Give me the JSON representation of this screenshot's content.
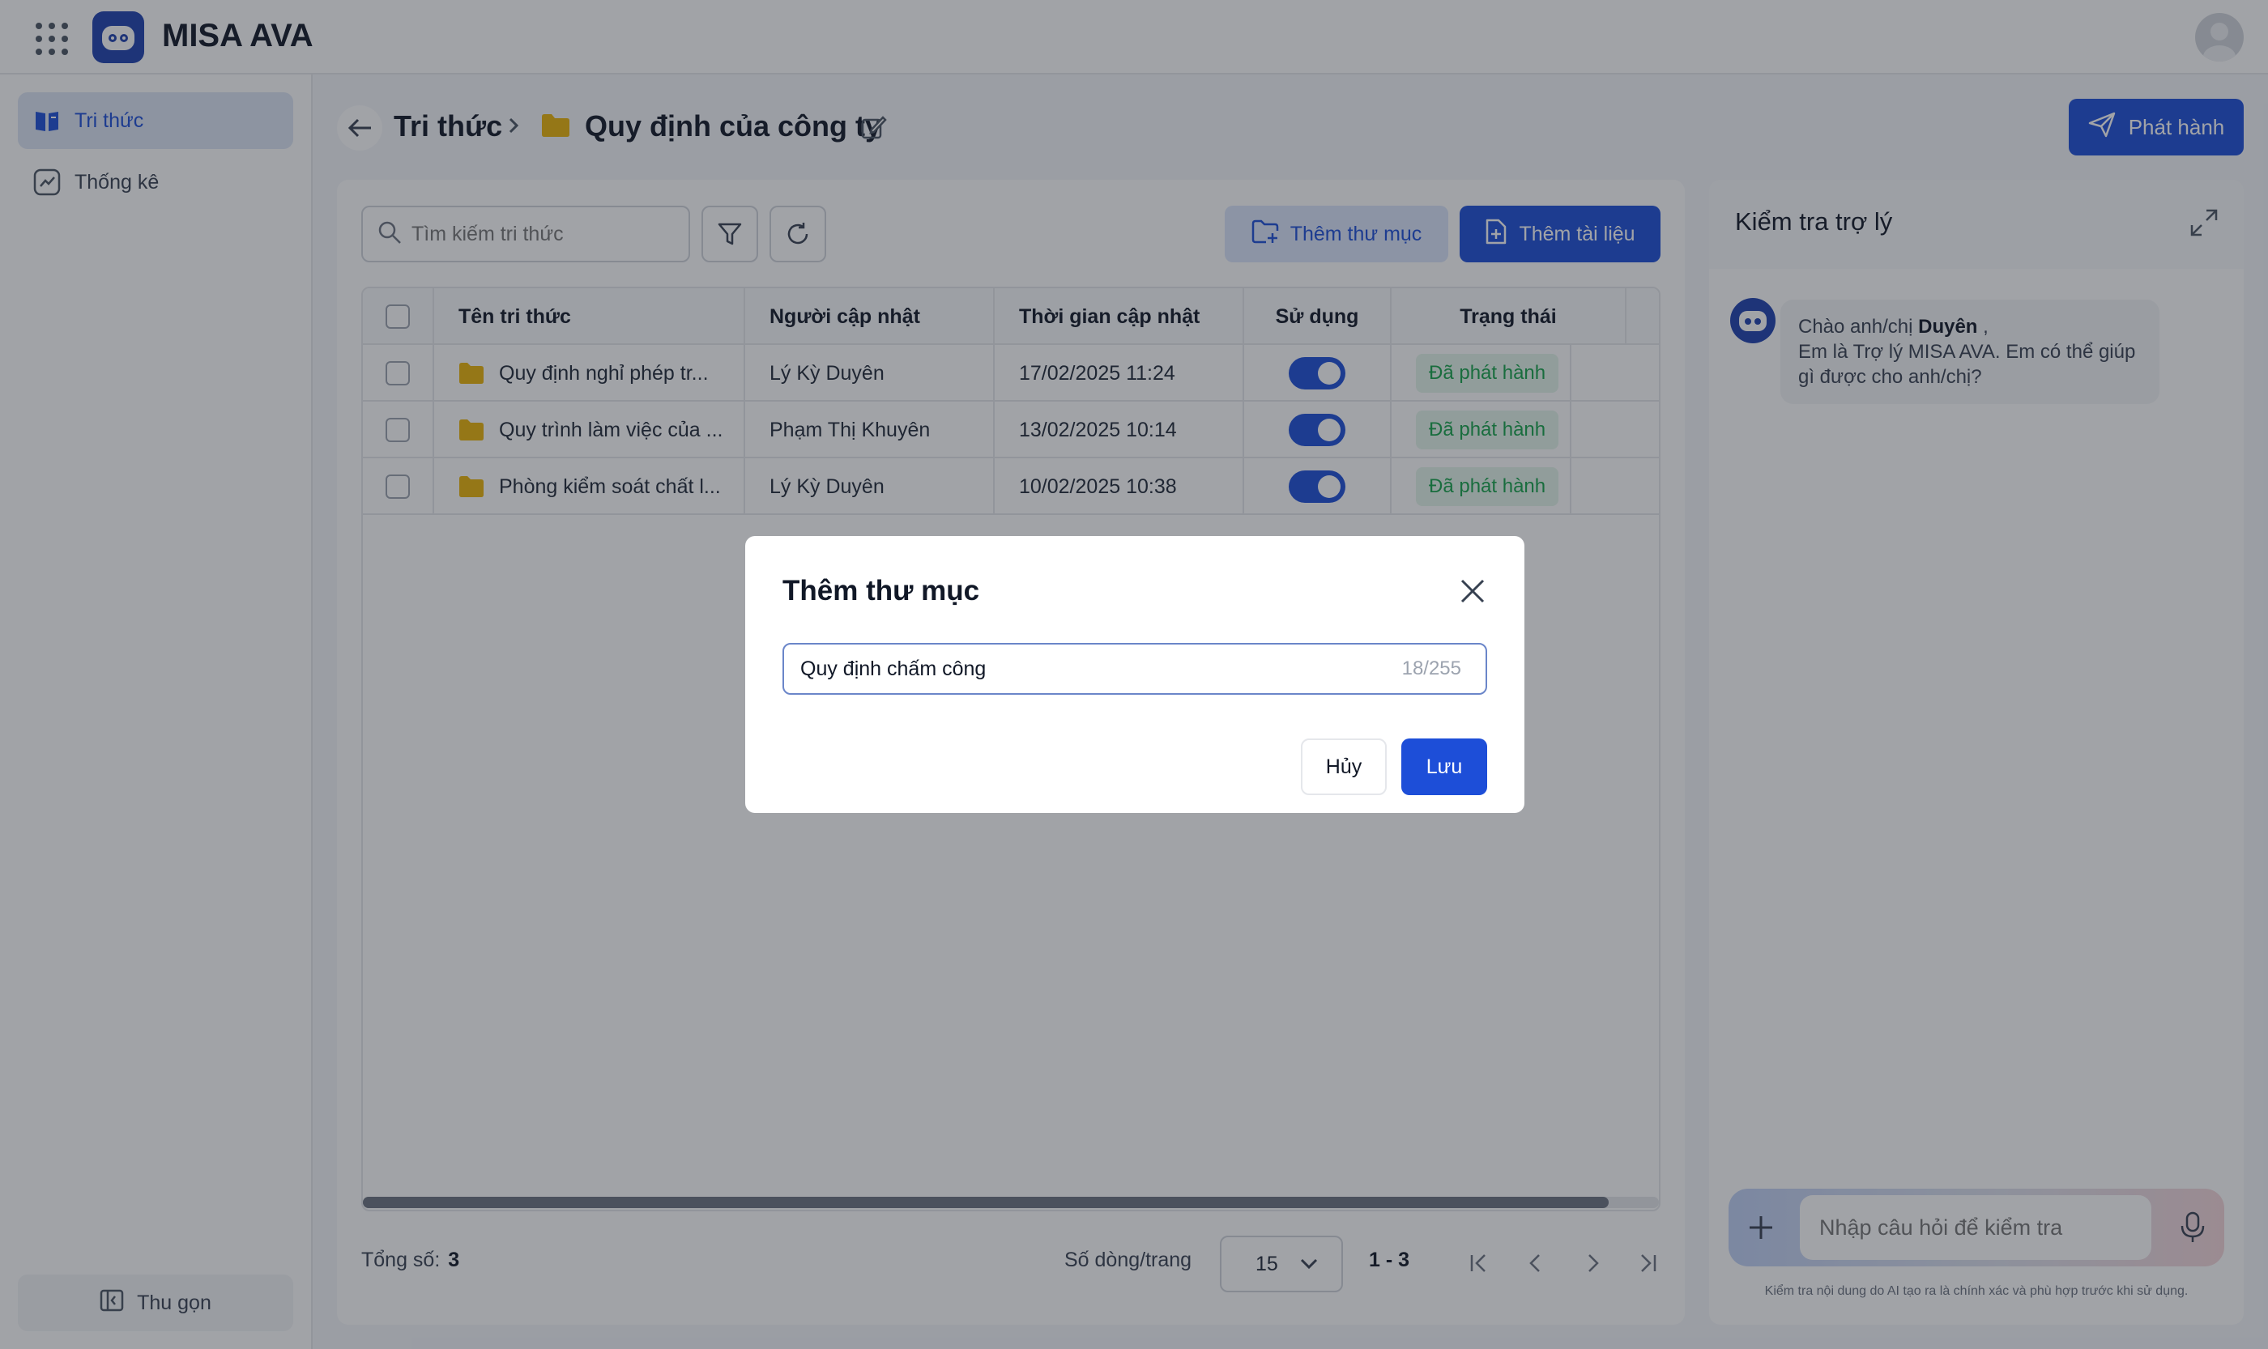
{
  "header": {
    "app_title": "MISA AVA",
    "apps_icon": "grid-apps-icon",
    "logo_icon": "robot-logo-icon"
  },
  "sidebar": {
    "items": [
      {
        "label": "Tri thức",
        "icon": "book-icon",
        "active": true
      },
      {
        "label": "Thống kê",
        "icon": "chart-icon",
        "active": false
      }
    ],
    "collapse_label": "Thu gọn"
  },
  "breadcrumb": {
    "root": "Tri thức",
    "current": "Quy định của công ty"
  },
  "publish_button": "Phát hành",
  "toolbar": {
    "search_placeholder": "Tìm kiếm tri thức",
    "add_folder": "Thêm thư mục",
    "add_document": "Thêm tài liệu"
  },
  "table": {
    "columns": [
      "Tên tri thức",
      "Người cập nhật",
      "Thời gian cập nhật",
      "Sử dụng",
      "Trạng thái"
    ],
    "rows": [
      {
        "name": "Quy định nghỉ phép tr...",
        "updater": "Lý Kỳ Duyên",
        "time": "17/02/2025 11:24",
        "in_use": true,
        "status": "Đã phát hành"
      },
      {
        "name": "Quy trình làm việc của ...",
        "updater": "Phạm Thị Khuyên",
        "time": "13/02/2025 10:14",
        "in_use": true,
        "status": "Đã phát hành"
      },
      {
        "name": "Phòng kiểm soát chất l...",
        "updater": "Lý Kỳ Duyên",
        "time": "10/02/2025 10:38",
        "in_use": true,
        "status": "Đã phát hành"
      }
    ]
  },
  "footer": {
    "total_label": "Tổng số:",
    "total_value": "3",
    "rows_per_page_label": "Số dòng/trang",
    "rows_per_page_value": "15",
    "range": "1 - 3"
  },
  "assistant": {
    "title": "Kiểm tra trợ lý",
    "greeting_prefix": "Chào anh/chị",
    "user_name": "Duyên",
    "greeting_suffix": ",",
    "message_line": "Em là Trợ lý MISA AVA. Em có thể giúp gì được cho anh/chị?",
    "input_placeholder": "Nhập câu hỏi để kiểm tra",
    "disclaimer": "Kiểm tra nội dung do AI tạo ra là chính xác và phù hợp trước khi sử dụng."
  },
  "modal": {
    "title": "Thêm thư mục",
    "input_value": "Quy định chấm công",
    "char_count": "18/255",
    "cancel_label": "Hủy",
    "save_label": "Lưu"
  },
  "colors": {
    "primary": "#1d4ed8",
    "folder": "#eab308",
    "status_green": "#16a34a",
    "status_bg": "#e3f5ea"
  }
}
